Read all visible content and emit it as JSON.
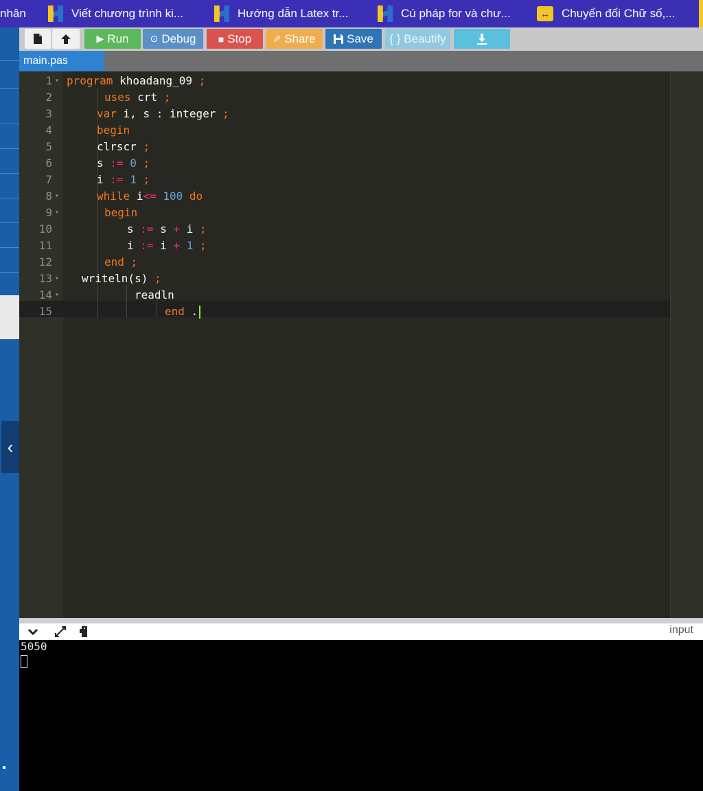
{
  "bookmarks": [
    {
      "label": "nhân",
      "icon": "none"
    },
    {
      "label": "Viết chương trình ki...",
      "icon": "h-logo-icon"
    },
    {
      "label": "Hướng dẫn Latex tr...",
      "icon": "h-logo-icon"
    },
    {
      "label": "Cú pháp for và chư...",
      "icon": "h-logo-icon"
    },
    {
      "label": "Chuyển đổi Chữ số,...",
      "icon": "convert-icon"
    }
  ],
  "toolbar": {
    "run": "Run",
    "debug": "Debug",
    "stop": "Stop",
    "share": "Share",
    "save": "Save",
    "beautify": "{ } Beautify"
  },
  "file_tab": "main.pas",
  "code_lines": [
    {
      "n": "1"
    },
    {
      "n": "2"
    },
    {
      "n": "3"
    },
    {
      "n": "4"
    },
    {
      "n": "5"
    },
    {
      "n": "6"
    },
    {
      "n": "7"
    },
    {
      "n": "8"
    },
    {
      "n": "9"
    },
    {
      "n": "10"
    },
    {
      "n": "11"
    },
    {
      "n": "12"
    },
    {
      "n": "13"
    },
    {
      "n": "14"
    },
    {
      "n": "15"
    }
  ],
  "code": {
    "l1": {
      "kw": "program",
      "name": "khoadang_09",
      "semi": ";"
    },
    "l2": {
      "kw": "uses",
      "name": "crt",
      "semi": ";"
    },
    "l3": {
      "kw": "var",
      "names": "i, s : integer",
      "semi": ";"
    },
    "l4": {
      "kw": "begin"
    },
    "l5": {
      "name": "clrscr",
      "semi": ";"
    },
    "l6": {
      "name": "s",
      "op": ":=",
      "num": "0",
      "semi": ";"
    },
    "l7": {
      "name": "i",
      "op": ":=",
      "num": "1",
      "semi": ";"
    },
    "l8": {
      "kw": "while",
      "name": "i",
      "op": "<=",
      "num": "100",
      "kw2": "do"
    },
    "l9": {
      "kw": "begin"
    },
    "l10": {
      "a": "s",
      "op": ":=",
      "b": "s",
      "plus": "+",
      "c": "i",
      "semi": ";"
    },
    "l11": {
      "a": "i",
      "op": ":=",
      "b": "i",
      "plus": "+",
      "num": "1",
      "semi": ";"
    },
    "l12": {
      "kw": "end",
      "semi": ";"
    },
    "l13": {
      "name": "writeln(s)",
      "semi": ";"
    },
    "l14": {
      "name": "readln"
    },
    "l15": {
      "kw": "end",
      "dot": "."
    }
  },
  "terminal": {
    "input_label": "input",
    "output": "5050"
  }
}
